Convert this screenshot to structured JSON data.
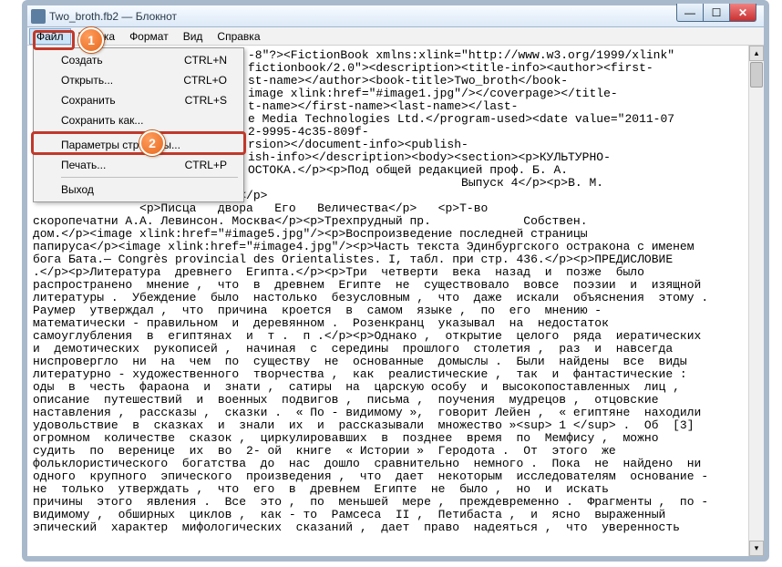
{
  "window": {
    "title": "Two_broth.fb2 — Блокнот"
  },
  "menubar": {
    "items": [
      "Файл",
      "Правка",
      "Формат",
      "Вид",
      "Справка"
    ],
    "active_index": 0
  },
  "dropdown": {
    "items": [
      {
        "label": "Создать",
        "shortcut": "CTRL+N"
      },
      {
        "label": "Открыть...",
        "shortcut": "CTRL+O"
      },
      {
        "label": "Сохранить",
        "shortcut": "CTRL+S"
      },
      {
        "label": "Сохранить как...",
        "shortcut": ""
      },
      {
        "sep": true
      },
      {
        "label": "Параметры страницы...",
        "shortcut": ""
      },
      {
        "label": "Печать...",
        "shortcut": "CTRL+P"
      },
      {
        "sep": true
      },
      {
        "label": "Выход",
        "shortcut": ""
      }
    ]
  },
  "callouts": {
    "c1": "1",
    "c2": "2"
  },
  "text": {
    "block1": "-8\"?><FictionBook xmlns:xlink=\"http://www.w3.org/1999/xlink\"\nfictionbook/2.0\"><description><title-info><author><first-\nst-name></author><book-title>Two_broth</book-\nimage xlink:href=\"#image1.jpg\"/></coverpage></title-\nt-name></first-name><last-name></last-\ne Media Technologies Ltd.</program-used><date value=\"2011-07\n2-9995-4c35-809f-\nrsion></document-info><publish-\nish-info></description><body><section><p>КУЛЬТУРНО-\nОСТОКА.</p><p>Под общей редакцией проф. Б. А.\n                              Выпуск 4</p><p>В. М.",
    "block2": "</p><p>ПОВЕСТЬ О ДВУХ БРАТЬЯХ</p>\n               <p>Писца   двора   Его   Величества</p>   <p>Т-во\nскоропечатни А.А. Левинсон. Москва</p><p>Трехпрудный пр.             Собствен.\nдом.</p><image xlink:href=\"#image5.jpg\"/><p>Воспроизведение последней страницы\nпапируса</p><image xlink:href=\"#image4.jpg\"/><p>Часть текста Эдинбургского остракона с именем\nбога Бата.— Congrès provincial des Orientalistes. I, табл. при стр. 436.</p><p>ПРЕДИСЛОВИЕ\n.</p><p>Литература  древнего  Египта.</p><p>Три  четверти  века  назад  и  позже  было\nраспространено  мнение ,  что  в  древнем  Египте  не  существовало  вовсе  поэзии  и  изящной\nлитературы .  Убеждение  было  настолько  безусловным ,  что  даже  искали  объяснения  этому .\nРаумер  утверждал ,  что  причина  кроется  в  самом  языке ,  по  его  мнению -\nматематически - правильном  и  деревянном .  Розенкранц  указывал  на  недостаток\nсамоуглубления  в  египтянах  и  т .  п .</p><p>Однако ,  открытие  целого  ряда  иератических\nи  демотических  рукописей ,  начиная  с  середины  прошлого  столетия ,  раз  и  навсегда\nниспровергло  ни  на  чем  по  существу  не  основанные  домыслы .  Были  найдены  все  виды\nлитературно - художественного  творчества ,  как  реалистические ,  так  и  фантастические :\nоды  в  честь  фараона  и  знати ,  сатиры  на  царскую особу  и  высокопоставленных  лиц ,\nописание  путешествий  и  военных  подвигов ,  письма ,  поучения  мудрецов ,  отцовские\nнаставления ,  рассказы ,  сказки .  « По - видимому »,  говорит Лейен ,  « египтяне  находили\nудовольствие  в  сказках  и  знали  их  и  рассказывали  множество »<sup> 1 </sup> .  Об  [3]\nогромном  количестве  сказок ,  циркулировавших  в  позднее  время  по  Мемфису ,  можно\nсудить  по  веренице  их  во  2- ой  книге  « Истории »  Геродота .  От  этого  же\nфольклористического  богатства  до  нас  дошло  сравнительно  немного .  Пока  не  найдено  ни\nодного  крупного  эпического  произведения ,  что  дает  некоторым  исследователям  основание -\nне  только  утверждать ,  что  его  в  древнем  Египте  не  было ,  но  и  искать\nпричины  этого  явления .  Все  это ,  по  меньшей  мере ,  преждевременно .  Фрагменты ,  по -\nвидимому ,  обширных  циклов ,  как - то  Рамсеса  II ,  Петибаста ,  и  ясно  выраженный\nэпический  характер  мифологических  сказаний ,  дает  право  надеяться ,  что  уверенность"
  }
}
